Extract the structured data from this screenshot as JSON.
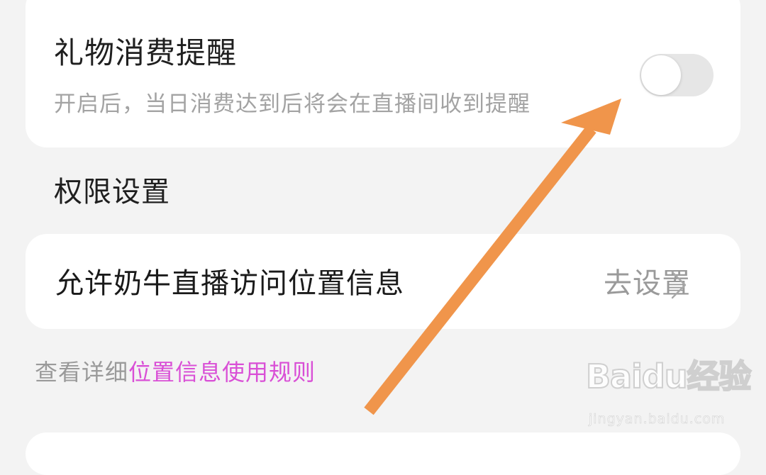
{
  "gift_reminder": {
    "title": "礼物消费提醒",
    "description": "开启后，当日消费达到后将会在直播间收到提醒",
    "toggle_on": false
  },
  "permissions_section": {
    "title": "权限设置"
  },
  "location_permission": {
    "label": "允许奶牛直播访问位置信息",
    "action_label": "去设置",
    "action_icon": "chevron-right-icon"
  },
  "footer": {
    "prefix": "查看详细",
    "link_label": "位置信息使用规则"
  },
  "watermark": {
    "logo_text": "Baidu经验",
    "url": "jingyan.baidu.com"
  },
  "colors": {
    "background": "#f3f3f3",
    "card": "#ffffff",
    "link": "#d94fd6",
    "annotation_arrow": "#f0954b",
    "toggle_off": "#e6e6e6"
  }
}
